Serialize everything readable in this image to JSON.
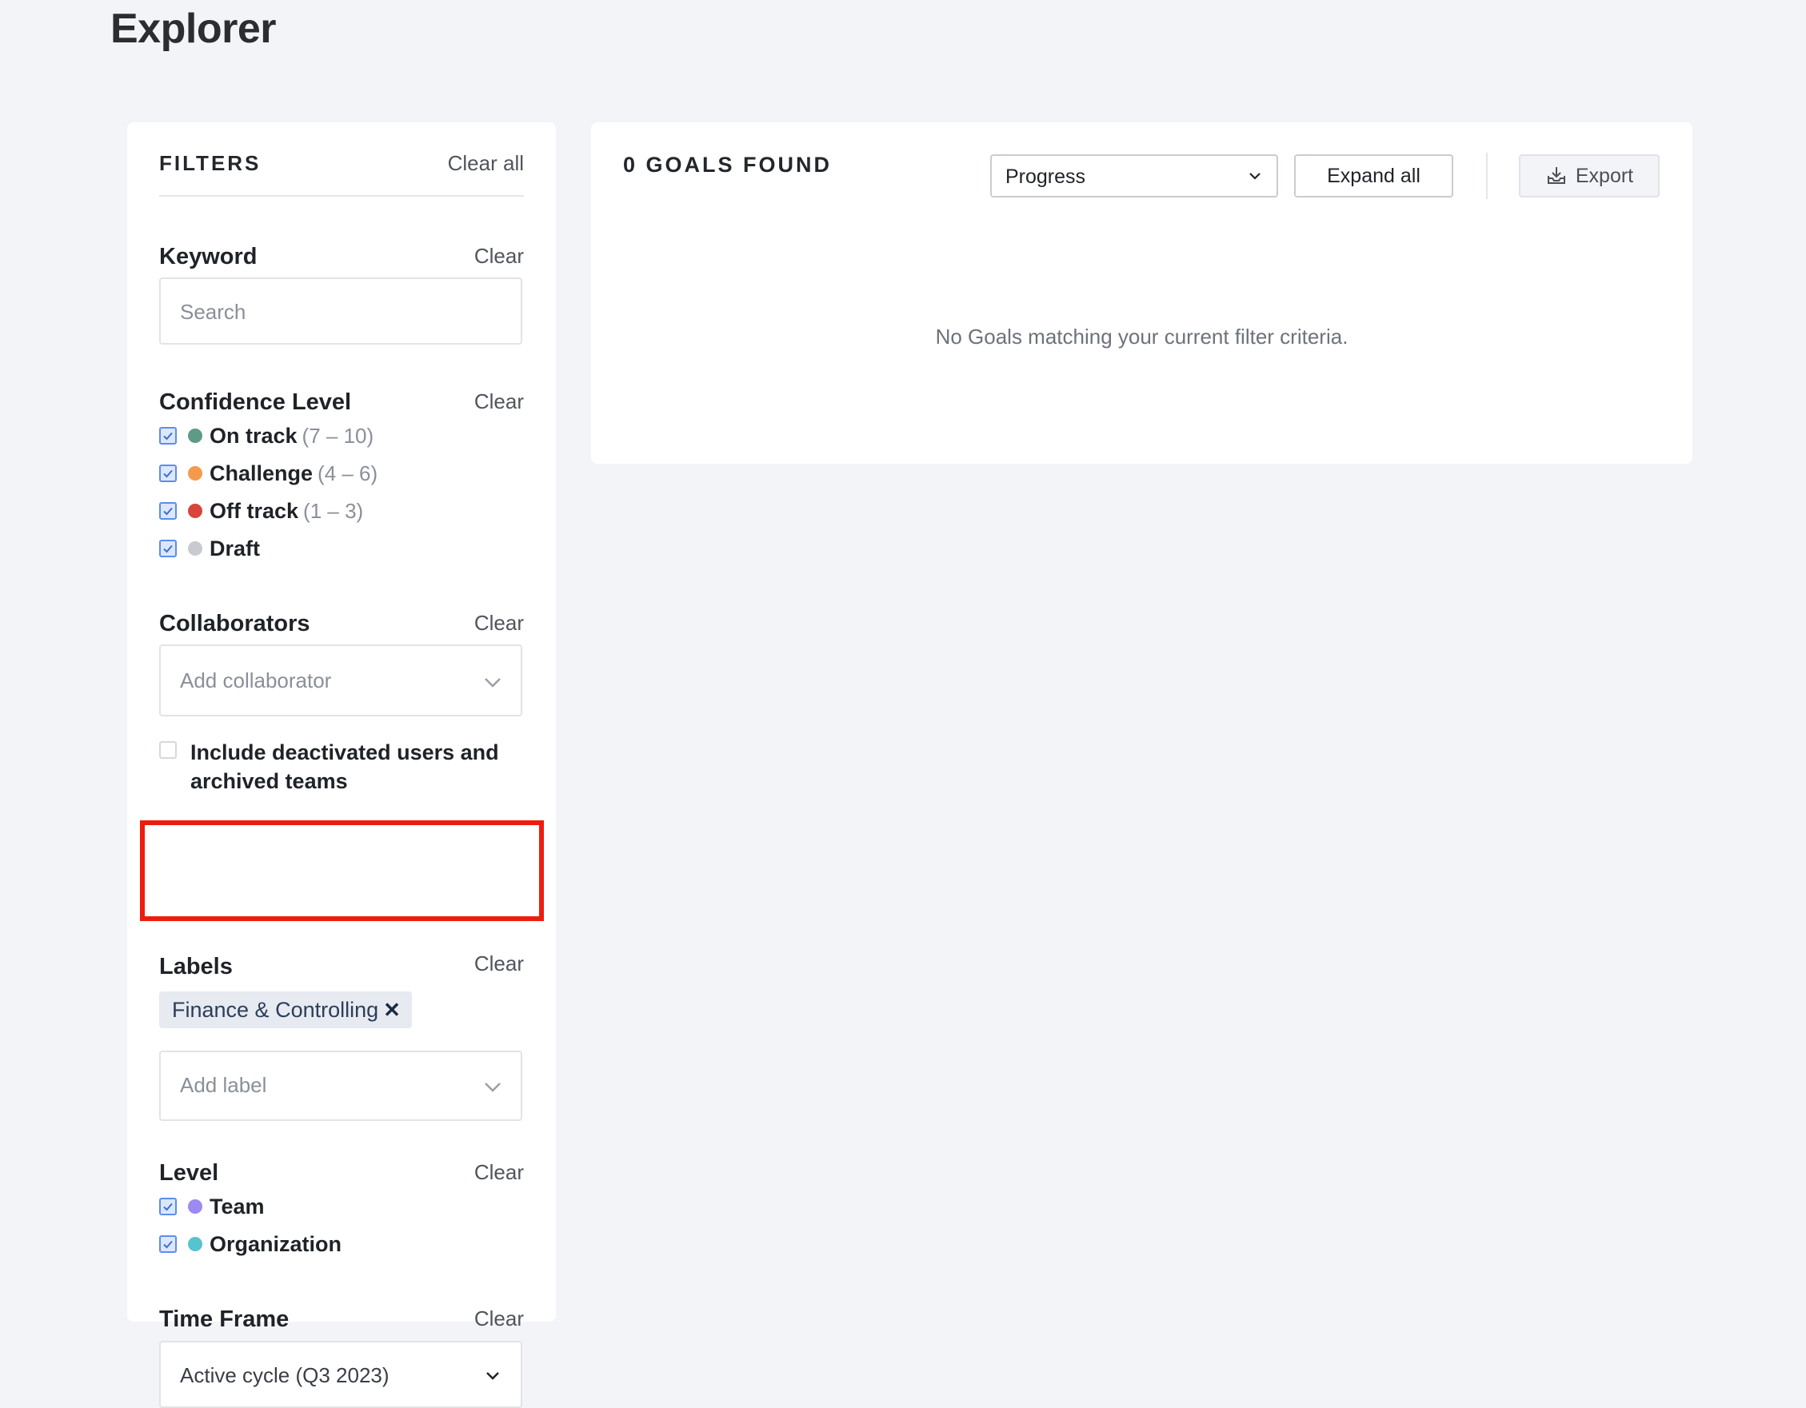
{
  "page": {
    "title": "Explorer"
  },
  "filters": {
    "heading": "FILTERS",
    "clear_all": "Clear all",
    "keyword": {
      "title": "Keyword",
      "clear": "Clear",
      "placeholder": "Search"
    },
    "confidence": {
      "title": "Confidence Level",
      "clear": "Clear",
      "items": [
        {
          "label": "On track",
          "range": "(7 – 10)",
          "color": "#5f9a86",
          "checked": true
        },
        {
          "label": "Challenge",
          "range": "(4 – 6)",
          "color": "#f59a4c",
          "checked": true
        },
        {
          "label": "Off track",
          "range": "(1 – 3)",
          "color": "#d9453b",
          "checked": true
        },
        {
          "label": "Draft",
          "range": "",
          "color": "#c8cad0",
          "checked": true
        }
      ]
    },
    "collaborators": {
      "title": "Collaborators",
      "clear": "Clear",
      "placeholder": "Add collaborator",
      "include_line1": "Include deactivated users and",
      "include_line2": "archived teams",
      "include_checked": false
    },
    "labels": {
      "title": "Labels",
      "clear": "Clear",
      "chips": [
        "Finance & Controlling"
      ],
      "chip_remove": "✕",
      "placeholder": "Add label"
    },
    "level": {
      "title": "Level",
      "clear": "Clear",
      "items": [
        {
          "label": "Team",
          "color": "#9c89f2",
          "checked": true
        },
        {
          "label": "Organization",
          "color": "#57c3cf",
          "checked": true
        }
      ]
    },
    "time_frame": {
      "title": "Time Frame",
      "clear": "Clear",
      "value": "Active cycle (Q3 2023)"
    }
  },
  "results": {
    "count_label": "0 GOALS FOUND",
    "sort_value": "Progress",
    "expand_label": "Expand all",
    "export_label": "Export",
    "empty_message": "No Goals matching your current filter criteria."
  },
  "colors": {
    "accent_checkbox": "#5b8def",
    "highlight": "#ee1c0e"
  },
  "icons": [
    "chevron-down-icon",
    "checkmark-icon",
    "close-icon",
    "download-icon"
  ]
}
